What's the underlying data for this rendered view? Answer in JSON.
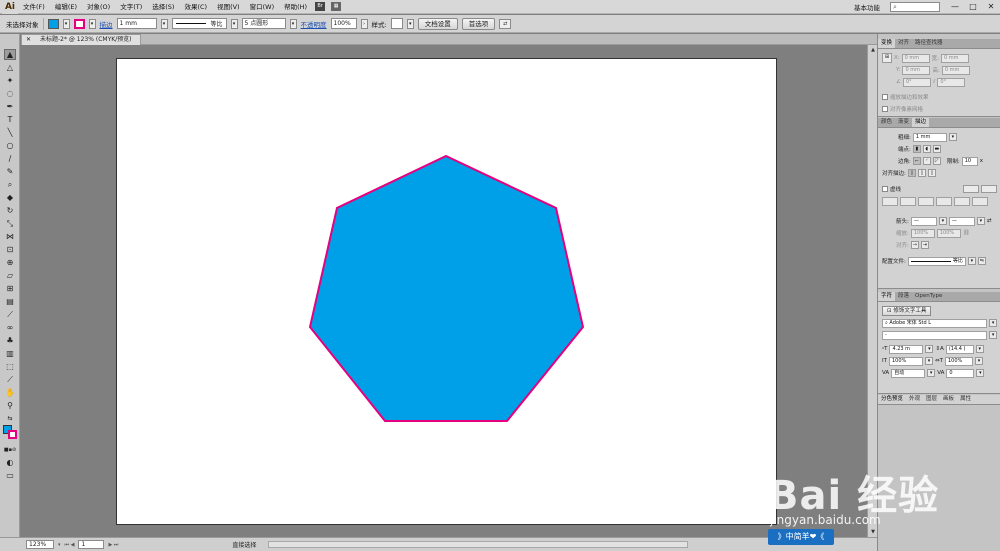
{
  "menubar": {
    "logo": "Ai",
    "items": [
      "文件(F)",
      "编辑(E)",
      "对象(O)",
      "文字(T)",
      "选择(S)",
      "效果(C)",
      "视图(V)",
      "窗口(W)",
      "帮助(H)"
    ],
    "workspace": "基本功能",
    "search_placeholder": "",
    "window_buttons": [
      "—",
      "□",
      "✕"
    ]
  },
  "controlbar": {
    "selection_status": "未选择对象",
    "fill_color": "#00a0e9",
    "stroke_color": "#e4007f",
    "stroke_link": "描边",
    "stroke_weight": "1 mm",
    "stroke_profile": "等比",
    "brush": "5 点圆形",
    "opacity_link": "不透明度",
    "opacity_value": "100%",
    "style_label": "样式:",
    "doc_setup_button": "文档设置",
    "preferences_button": "首选项"
  },
  "document": {
    "tab_title": "未标题-2* @ 123% (CMYK/预览)",
    "shape": {
      "type": "heptagon",
      "fill": "#00a0e9",
      "stroke": "#e4007f"
    }
  },
  "statusbar": {
    "zoom": "123%",
    "artboard_number": "1",
    "tool_name": "直接选择"
  },
  "panels": {
    "transform": {
      "tabs": [
        "变换",
        "对齐",
        "路径查找器"
      ],
      "x": "0 mm",
      "y": "0 mm",
      "w": "0 mm",
      "h": "0 mm",
      "angle": "0°",
      "shear": "0°",
      "option1": "缩放描边和效果",
      "option2": "对齐像素网格"
    },
    "stroke": {
      "tabs": [
        "颜色",
        "渐变",
        "描边"
      ],
      "weight_label": "粗细:",
      "weight_value": "1 mm",
      "cap_label": "端点:",
      "corner_label": "边角:",
      "limit_label": "限制:",
      "limit_value": "10",
      "limit_unit": "x",
      "align_label": "对齐描边:",
      "dashed_label": "虚线",
      "arrow_label": "箭头:",
      "scale_label": "缩放:",
      "scale1": "100%",
      "scale2": "100%",
      "align2_label": "对齐:",
      "profile_label": "配置文件:",
      "profile_value": "等比"
    },
    "character": {
      "tabs": [
        "字符",
        "段落",
        "OpenType"
      ],
      "touch_type_button": "修饰文字工具",
      "font_family": "Adobe 宋体 Std L",
      "font_style": "-",
      "font_size": "4.23 m",
      "leading": "(14.4 )",
      "hscale": "100%",
      "vscale": "100%",
      "tracking": "自动",
      "kerning": "0"
    },
    "bottom_tabs": [
      "分色预览",
      "外观",
      "图层",
      "画板",
      "属性"
    ]
  },
  "watermark": {
    "main": "Bai 经验",
    "url": "jingyan.baidu.com",
    "badge": "》中简羊❤《"
  }
}
